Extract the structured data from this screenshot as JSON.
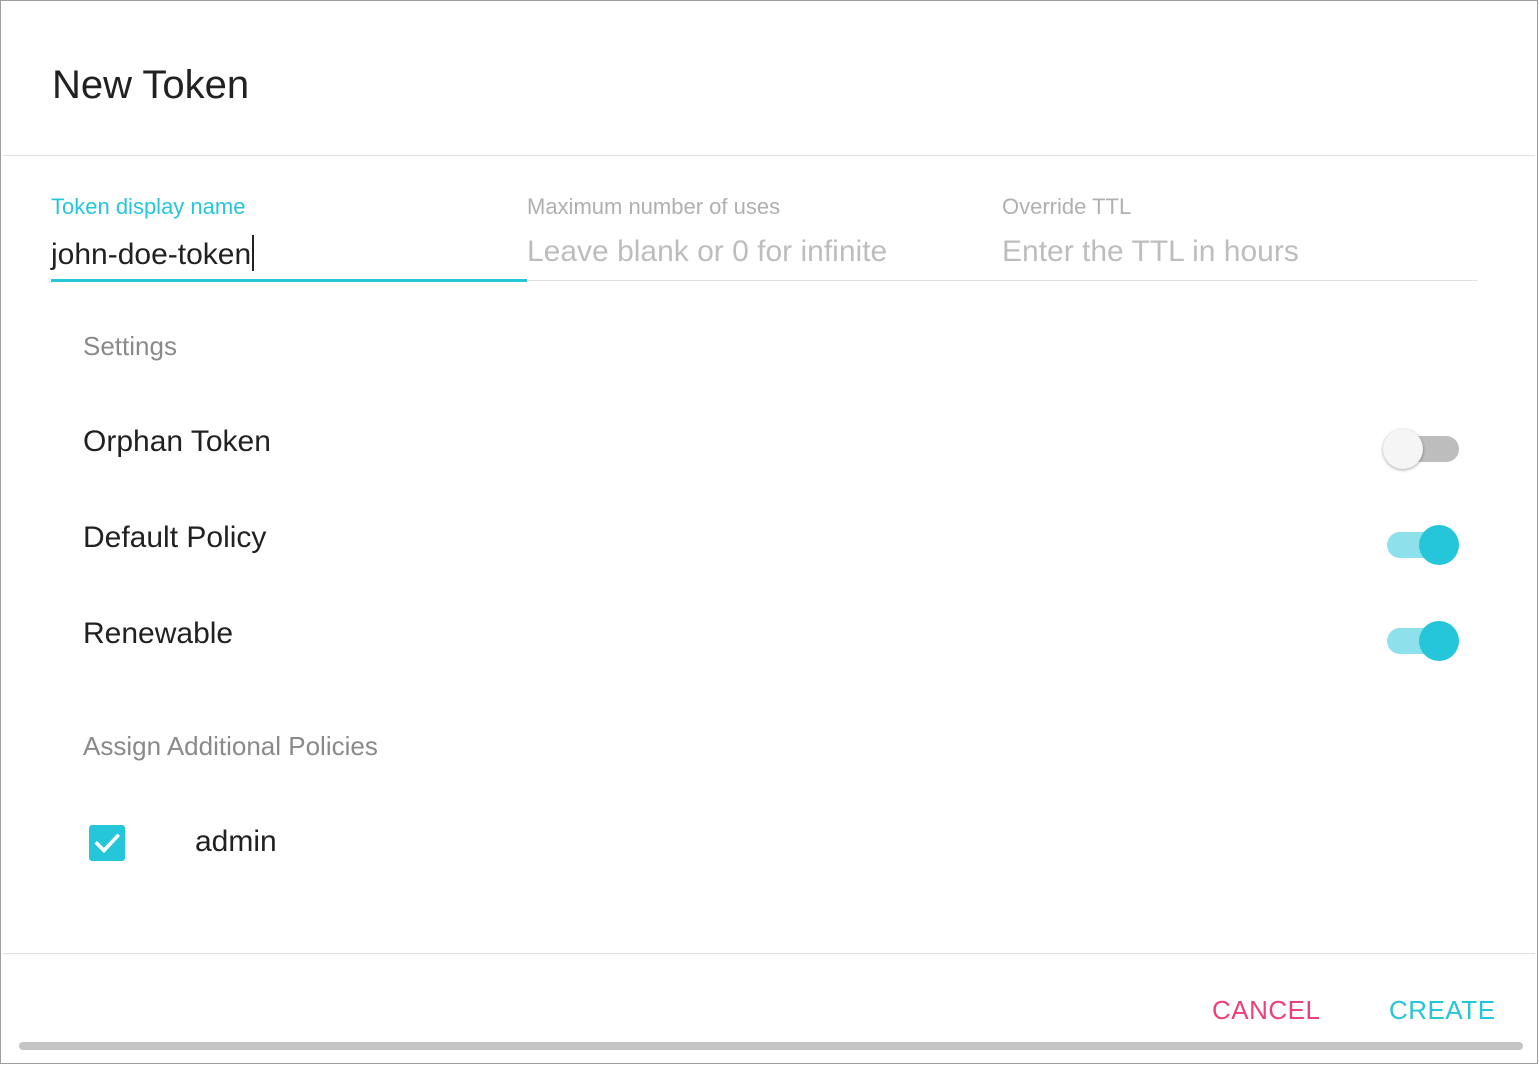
{
  "dialog": {
    "title": "New Token"
  },
  "fields": {
    "display_name": {
      "label": "Token display name",
      "value": "john-doe-token"
    },
    "max_uses": {
      "label": "Maximum number of uses",
      "placeholder": "Leave blank or 0 for infinite"
    },
    "ttl": {
      "label": "Override TTL",
      "placeholder": "Enter the TTL in hours"
    }
  },
  "settings": {
    "heading": "Settings",
    "toggles": [
      {
        "label": "Orphan Token",
        "on": false
      },
      {
        "label": "Default Policy",
        "on": true
      },
      {
        "label": "Renewable",
        "on": true
      }
    ]
  },
  "policies": {
    "heading": "Assign Additional Policies",
    "items": [
      {
        "label": "admin",
        "checked": true
      }
    ]
  },
  "actions": {
    "cancel_label": "CANCEL",
    "create_label": "CREATE"
  },
  "colors": {
    "accent": "#26c6da",
    "cancel": "#ec407a",
    "text": "#212121",
    "muted": "#8a8a8a"
  }
}
